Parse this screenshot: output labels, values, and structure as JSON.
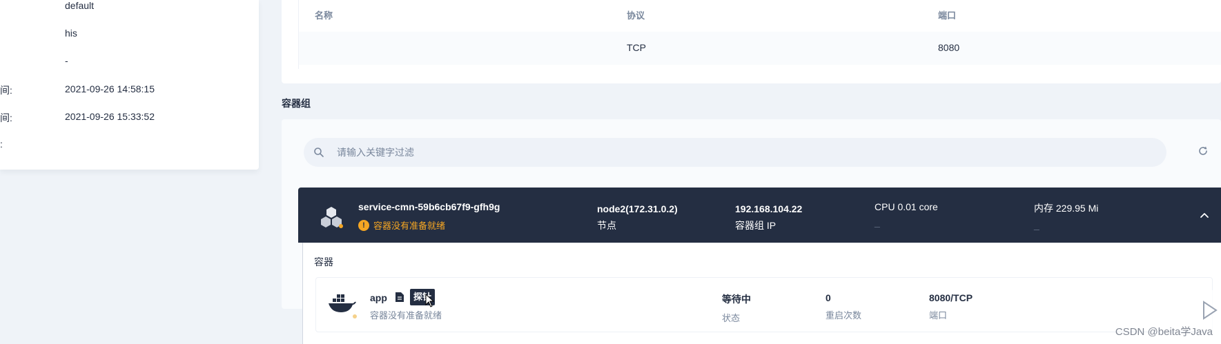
{
  "detail_info": {
    "rows": [
      {
        "label": "",
        "value": "default"
      },
      {
        "label": "",
        "value": "his"
      },
      {
        "label": "",
        "value": "-"
      },
      {
        "label": "间:",
        "value": "2021-09-26 14:58:15"
      },
      {
        "label": "间:",
        "value": "2021-09-26 15:33:52"
      },
      {
        "label": ":",
        "value": ""
      }
    ]
  },
  "ports": {
    "headers": {
      "name": "名称",
      "protocol": "协议",
      "port": "端口"
    },
    "rows": [
      {
        "name": "",
        "protocol": "TCP",
        "port": "8080"
      }
    ]
  },
  "pods_section": {
    "title": "容器组",
    "search_placeholder": "请输入关键字过滤",
    "pod": {
      "name": "service-cmn-59b6cb67f9-gfh9g",
      "warning": "容器没有准备就绪",
      "node_value": "node2(172.31.0.2)",
      "node_label": "节点",
      "ip_value": "192.168.104.22",
      "ip_label": "容器组 IP",
      "cpu_value": "CPU 0.01 core",
      "cpu_label": "_",
      "mem_value": "内存 229.95 Mi",
      "mem_label": "_"
    },
    "containers_title": "容器",
    "container": {
      "name": "app",
      "probe_label": "探针",
      "status_text": "容器没有准备就绪",
      "state_value": "等待中",
      "state_label": "状态",
      "restarts_value": "0",
      "restarts_label": "重启次数",
      "port_value": "8080/TCP",
      "port_label": "端口"
    }
  },
  "watermark": "CSDN @beita学Java",
  "colors": {
    "dark_header": "#242e42",
    "warning": "#f5a623",
    "page_bg": "#eff3f8"
  }
}
